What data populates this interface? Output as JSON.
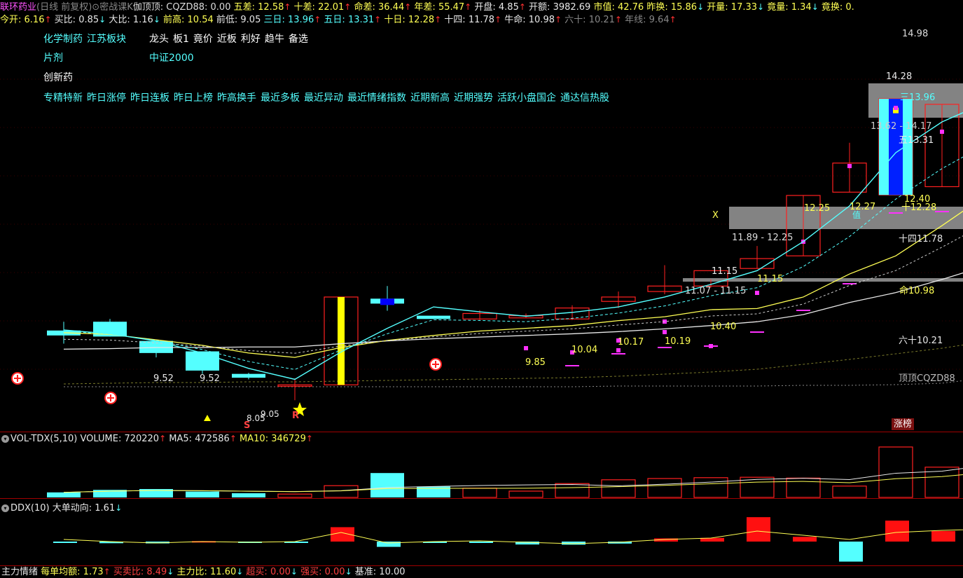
{
  "header": {
    "row1": [
      {
        "t": "联环药业",
        "cls": "m"
      },
      {
        "t": "(日线 前复权)",
        "cls": "g"
      },
      {
        "t": "⊙",
        "cls": "g",
        "icon": "dropdown-icon"
      },
      {
        "t": "密战课K",
        "cls": "g"
      },
      {
        "t": "伽顶顶: ",
        "cls": "lbl"
      },
      {
        "t": "CQZD88: 0.00",
        "cls": "lbl"
      },
      {
        "t": " 五差: ",
        "cls": "y"
      },
      {
        "t": "12.58",
        "cls": "y"
      },
      {
        "t": "↑",
        "cls": "arrow-up"
      },
      {
        "t": " 十差: ",
        "cls": "y"
      },
      {
        "t": "22.01",
        "cls": "y"
      },
      {
        "t": "↑",
        "cls": "arrow-up"
      },
      {
        "t": " 命差: ",
        "cls": "y"
      },
      {
        "t": "36.44",
        "cls": "y"
      },
      {
        "t": "↑",
        "cls": "arrow-up"
      },
      {
        "t": " 年差: ",
        "cls": "y"
      },
      {
        "t": "55.47",
        "cls": "y"
      },
      {
        "t": "↑",
        "cls": "arrow-up"
      },
      {
        "t": " 开盘: ",
        "cls": "w"
      },
      {
        "t": "4.85",
        "cls": "w"
      },
      {
        "t": "↑",
        "cls": "arrow-up"
      },
      {
        "t": " 开额: ",
        "cls": "w"
      },
      {
        "t": "3982.69",
        "cls": "w"
      },
      {
        "t": " 市值: ",
        "cls": "y"
      },
      {
        "t": "42.76",
        "cls": "y"
      },
      {
        "t": " 昨换: ",
        "cls": "y"
      },
      {
        "t": "15.86",
        "cls": "y"
      },
      {
        "t": "↓",
        "cls": "arrow-dn"
      },
      {
        "t": " 开量: ",
        "cls": "y"
      },
      {
        "t": "17.33",
        "cls": "y"
      },
      {
        "t": "↓",
        "cls": "arrow-dn"
      },
      {
        "t": " 竟量: ",
        "cls": "y"
      },
      {
        "t": "1.34",
        "cls": "y"
      },
      {
        "t": "↓",
        "cls": "arrow-dn"
      },
      {
        "t": " 竟换: ",
        "cls": "y"
      },
      {
        "t": "0.",
        "cls": "y"
      }
    ],
    "row2": [
      {
        "t": "今开: ",
        "cls": "y"
      },
      {
        "t": "6.16",
        "cls": "y"
      },
      {
        "t": "↑",
        "cls": "arrow-up"
      },
      {
        "t": " 买比: ",
        "cls": "w"
      },
      {
        "t": "0.85",
        "cls": "w"
      },
      {
        "t": "↓",
        "cls": "arrow-dn"
      },
      {
        "t": " 大比: ",
        "cls": "w"
      },
      {
        "t": "1.16",
        "cls": "w"
      },
      {
        "t": "↓",
        "cls": "arrow-dn"
      },
      {
        "t": " 前高: ",
        "cls": "y"
      },
      {
        "t": "10.54",
        "cls": "y"
      },
      {
        "t": " 前低: ",
        "cls": "w"
      },
      {
        "t": "9.05",
        "cls": "w"
      },
      {
        "t": " 三日: ",
        "cls": "c"
      },
      {
        "t": "13.96",
        "cls": "c"
      },
      {
        "t": "↑",
        "cls": "arrow-up"
      },
      {
        "t": " 五日: ",
        "cls": "c"
      },
      {
        "t": "13.31",
        "cls": "c"
      },
      {
        "t": "↑",
        "cls": "arrow-up"
      },
      {
        "t": " 十日: ",
        "cls": "y"
      },
      {
        "t": "12.28",
        "cls": "y"
      },
      {
        "t": "↑",
        "cls": "arrow-up"
      },
      {
        "t": " 十四: ",
        "cls": "w"
      },
      {
        "t": "11.78",
        "cls": "w"
      },
      {
        "t": "↑",
        "cls": "arrow-up"
      },
      {
        "t": " 牛命: ",
        "cls": "w"
      },
      {
        "t": "10.98",
        "cls": "w"
      },
      {
        "t": "↑",
        "cls": "arrow-up"
      },
      {
        "t": " 六十: ",
        "cls": "g"
      },
      {
        "t": "10.21",
        "cls": "g"
      },
      {
        "t": "↑",
        "cls": "arrow-up"
      },
      {
        "t": " 年线: ",
        "cls": "g"
      },
      {
        "t": "9.64",
        "cls": "g"
      },
      {
        "t": "↑",
        "cls": "arrow-up"
      }
    ]
  },
  "tags": {
    "line1": [
      "化学制药",
      "江苏板块"
    ],
    "line1b": [
      "龙头",
      "板1",
      "竟价",
      "近板",
      "利好",
      "趋牛",
      "备选"
    ],
    "line2": [
      "片剂"
    ],
    "line2b": [
      "中证2000"
    ],
    "line3": [
      "创新药"
    ],
    "line4": [
      "专精特新",
      "昨日涨停",
      "昨日连板",
      "昨日上榜",
      "昨高换手",
      "最近多板",
      "最近异动",
      "最近情绪指数",
      "近期新高",
      "近期强势",
      "活跃小盘国企",
      "通达信热股"
    ]
  },
  "price_labels": {
    "high": "14.98",
    "top_box": "14.28",
    "ma3": "三13.96",
    "range1": "13.62 - 14.17",
    "ma5": "五13.31",
    "ma10_a": "12.40",
    "ma10_b": "十12.28",
    "v1225": "12.25",
    "v1227": "12.27",
    "zhi": "值",
    "x_mark": "X",
    "range2": "11.89 - 12.25",
    "ma14": "十四11.78",
    "v1115a": "11.15",
    "v1115b": "11.15",
    "range3": "11.07 - 11.15",
    "ma_life": "命10.98",
    "v1040": "10.40",
    "ma60": "六十10.21",
    "v1019": "10.19",
    "v1017": "10.17",
    "v1004": "10.04",
    "v985": "9.85",
    "cqzd": "顶顶CQZD88",
    "v952a": "9.52",
    "v952b": "9.52",
    "low_a": "9.05",
    "low_b": "8.05",
    "sig_s": "S",
    "sig_r": "R",
    "zhangbang": "涨榜"
  },
  "vol_panel": {
    "name": "VOL-TDX(5,10)",
    "volume_label": "VOLUME: ",
    "volume": "720220",
    "ma5_label": "MA5: ",
    "ma5": "472586",
    "ma10_label": "MA10: ",
    "ma10": "346729",
    "up_arrow": "↑"
  },
  "ddx_panel": {
    "name": "DDX(10)",
    "label": "大单动向: ",
    "value": "1.61",
    "arrow": "↓"
  },
  "bottom_bar": [
    {
      "t": "主力情绪",
      "cls": "w"
    },
    {
      "t": " 每单均额: ",
      "cls": "y"
    },
    {
      "t": "1.73",
      "cls": "y"
    },
    {
      "t": "↑",
      "cls": "arrow-up"
    },
    {
      "t": " 买卖比: ",
      "cls": "r"
    },
    {
      "t": "8.49",
      "cls": "r"
    },
    {
      "t": "↓",
      "cls": "arrow-dn"
    },
    {
      "t": " 主力比: ",
      "cls": "y"
    },
    {
      "t": "11.60",
      "cls": "y"
    },
    {
      "t": "↓",
      "cls": "arrow-dn"
    },
    {
      "t": " 超买: ",
      "cls": "r"
    },
    {
      "t": "0.00",
      "cls": "r"
    },
    {
      "t": "↓",
      "cls": "arrow-dn"
    },
    {
      "t": " 强买: ",
      "cls": "r"
    },
    {
      "t": "0.00",
      "cls": "r"
    },
    {
      "t": "↓",
      "cls": "arrow-dn"
    },
    {
      "t": " 基准: ",
      "cls": "w"
    },
    {
      "t": "10.00",
      "cls": "w"
    }
  ],
  "colors": {
    "up": "#ff2020",
    "down": "#54ffff",
    "ma3": "#54ffff",
    "ma10": "#ffff54",
    "ma_life": "#e8e8e8",
    "zone": "#9a9a9a"
  },
  "chart_data": {
    "type": "candlestick",
    "title": "联环药业",
    "ylim": [
      8.0,
      15.3
    ],
    "candles": [
      {
        "o": 9.79,
        "h": 9.95,
        "l": 9.55,
        "c": 9.7
      },
      {
        "o": 9.95,
        "h": 10.0,
        "l": 9.68,
        "c": 9.68
      },
      {
        "o": 9.6,
        "h": 9.6,
        "l": 9.3,
        "c": 9.38
      },
      {
        "o": 9.41,
        "h": 9.41,
        "l": 9.0,
        "c": 9.06
      },
      {
        "o": 9.0,
        "h": 9.02,
        "l": 8.9,
        "c": 8.93
      },
      {
        "o": 8.78,
        "h": 8.92,
        "l": 8.52,
        "c": 8.8
      },
      {
        "o": 8.8,
        "h": 10.4,
        "l": 8.8,
        "c": 10.4
      },
      {
        "o": 10.37,
        "h": 10.6,
        "l": 10.15,
        "c": 10.28
      },
      {
        "o": 10.06,
        "h": 10.06,
        "l": 10.0,
        "c": 10.0
      },
      {
        "o": 10.0,
        "h": 10.16,
        "l": 9.98,
        "c": 10.1
      },
      {
        "o": 10.02,
        "h": 10.1,
        "l": 10.02,
        "c": 10.06
      },
      {
        "o": 10.0,
        "h": 10.25,
        "l": 9.98,
        "c": 10.2
      },
      {
        "o": 10.32,
        "h": 10.5,
        "l": 10.2,
        "c": 10.4
      },
      {
        "o": 10.5,
        "h": 10.98,
        "l": 10.45,
        "c": 10.6
      },
      {
        "o": 10.6,
        "h": 10.72,
        "l": 10.57,
        "c": 10.88
      },
      {
        "o": 10.92,
        "h": 11.33,
        "l": 10.92,
        "c": 11.1
      },
      {
        "o": 11.15,
        "h": 12.25,
        "l": 11.15,
        "c": 12.25
      },
      {
        "o": 12.31,
        "h": 13.21,
        "l": 12.31,
        "c": 12.84
      },
      {
        "o": 12.26,
        "h": 14.01,
        "l": 12.26,
        "c": 14.01
      },
      {
        "o": 12.41,
        "h": 13.91,
        "l": 12.41,
        "c": 13.91
      },
      {
        "o": 14.32,
        "h": 15.2,
        "l": 14.32,
        "c": 15.2
      }
    ],
    "ma3": [
      9.8,
      9.73,
      9.6,
      9.38,
      9.1,
      8.9,
      9.4,
      9.83,
      10.22,
      10.13,
      10.05,
      10.12,
      10.22,
      10.4,
      10.63,
      10.88,
      11.41,
      12.06,
      13.03,
      13.59,
      13.96
    ],
    "ma10": [
      9.75,
      9.72,
      9.62,
      9.52,
      9.38,
      9.3,
      9.48,
      9.61,
      9.7,
      9.78,
      9.83,
      9.88,
      9.97,
      10.04,
      10.17,
      10.19,
      10.4,
      10.82,
      11.15,
      11.7,
      12.28
    ],
    "ma_life": [
      9.45,
      9.46,
      9.48,
      9.48,
      9.49,
      9.49,
      9.55,
      9.6,
      9.64,
      9.67,
      9.7,
      9.73,
      9.77,
      9.82,
      9.88,
      9.95,
      10.08,
      10.3,
      10.48,
      10.72,
      10.98
    ],
    "volume": [
      120,
      180,
      200,
      140,
      100,
      80,
      280,
      580,
      260,
      220,
      150,
      330,
      420,
      450,
      470,
      480,
      460,
      270,
      1200,
      720,
      1190
    ],
    "ddx": [
      -0.1,
      -0.18,
      -0.2,
      0.05,
      -0.1,
      -0.05,
      1.58,
      -0.58,
      -0.12,
      -0.15,
      -0.32,
      -0.34,
      -0.22,
      0.35,
      0.4,
      2.68,
      0.52,
      -2.2,
      2.3,
      1.16
    ]
  }
}
